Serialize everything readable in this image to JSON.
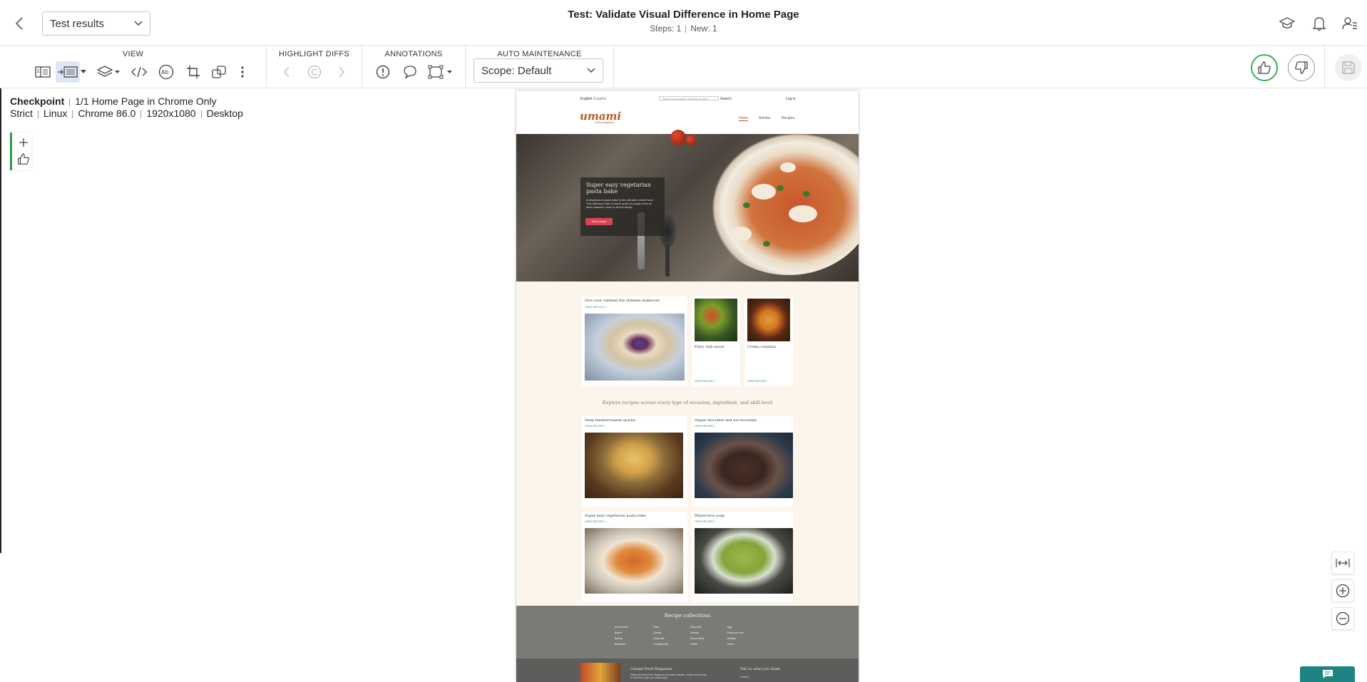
{
  "header": {
    "back_icon": "chevron-left-icon",
    "results_select": "Test results",
    "title": "Test: Validate Visual Difference in Home Page",
    "steps_label": "Steps: 1",
    "new_label": "New: 1",
    "icons": [
      "graduation-cap-icon",
      "bell-icon",
      "user-settings-icon"
    ]
  },
  "toolbar": {
    "view_label": "VIEW",
    "highlight_label": "HIGHLIGHT DIFFS",
    "annotations_label": "ANNOTATIONS",
    "auto_label": "AUTO MAINTENANCE",
    "scope_value": "Scope: Default"
  },
  "checkpoint": {
    "label": "Checkpoint",
    "name": "1/1 Home Page in Chrome Only",
    "details": [
      "Strict",
      "Linux",
      "Chrome 86.0",
      "1920x1080",
      "Desktop"
    ]
  },
  "site": {
    "lang1": "English",
    "lang2": "Español",
    "search_placeholder": "Search by keyword, ingredient, dish",
    "search_btn": "Search",
    "login": "Log in",
    "logo": "umami",
    "logo_sub": "Food Magazine",
    "nav": [
      "Home",
      "Articles",
      "Recipes"
    ],
    "hero_title": "Super easy vegetarian pasta bake",
    "hero_desc": "A wholesome pasta bake is the ultimate comfort food. This delicious bake is super quick to prepare and an ideal midweek meal for all the family.",
    "hero_btn": "View recipe",
    "feature_title": "Give your oatmeal the ultimate makeover",
    "view_article": "VIEW ARTICLE >",
    "view_recipe": "VIEW RECIPE >",
    "card2": "Fiery chili sauce",
    "card3": "Crema catalana",
    "explore": "Explore recipes across every type of occasion, ingredient, and skill level",
    "grid": [
      "Deep mediterranean quiche",
      "Vegan chocolate and nut brownies",
      "Super easy vegetarian pasta bake",
      "Watercress soup"
    ],
    "collections_title": "Recipe collections",
    "collections": [
      [
        "Alcohol free",
        "Baked",
        "Baking",
        "Breakfast"
      ],
      [
        "Cake",
        "Carrots",
        "Chocolate",
        "Cocktail party"
      ],
      [
        "Dairy-free",
        "Dessert",
        "Dinner party",
        "Drinks"
      ],
      [
        "Egg",
        "Grow your own",
        "Healthy",
        "Herbs"
      ]
    ],
    "footer_mag": "Umami Food Magazine",
    "footer_mag_desc": "Skills and know-how. Magazine exclusive articles, recipes and plenty of reasons to get your copy today.",
    "footer_tell": "Tell us what you think",
    "footer_contact": "Contact"
  }
}
